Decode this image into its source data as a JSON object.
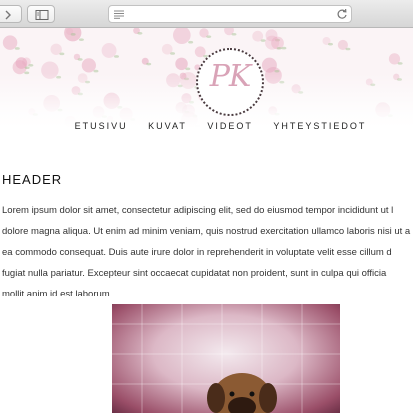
{
  "browser": {
    "back_icon": "chevron-left-icon",
    "forward_icon": "chevron-right-icon",
    "sidebar_icon": "sidebar-icon",
    "reader_icon": "reader-lines-icon",
    "reload_icon": "reload-icon"
  },
  "site": {
    "logo_text": "PK",
    "nav": [
      "ETUSIVU",
      "KUVAT",
      "VIDEOT",
      "YHTEYSTIEDOT"
    ]
  },
  "content": {
    "heading": "HEADER",
    "paragraph_lines": [
      "Lorem ipsum dolor sit amet, consectetur adipiscing elit, sed do eiusmod tempor incididunt ut l",
      "dolore magna aliqua. Ut enim ad minim veniam, quis nostrud exercitation ullamco laboris nisi ut a",
      "ea commodo consequat. Duis aute irure dolor in reprehenderit in voluptate velit esse cillum d",
      "fugiat nulla pariatur. Excepteur sint occaecat cupidatat non proident, sunt in culpa qui officia",
      "mollit anim id est laborum."
    ],
    "photo_subject": "puppy-photo"
  },
  "colors": {
    "banner_pink": "#fbf4f6",
    "rose": "#e7a9bf",
    "logo_text": "#d9a3b7",
    "photo_border": "#9a4e68"
  }
}
